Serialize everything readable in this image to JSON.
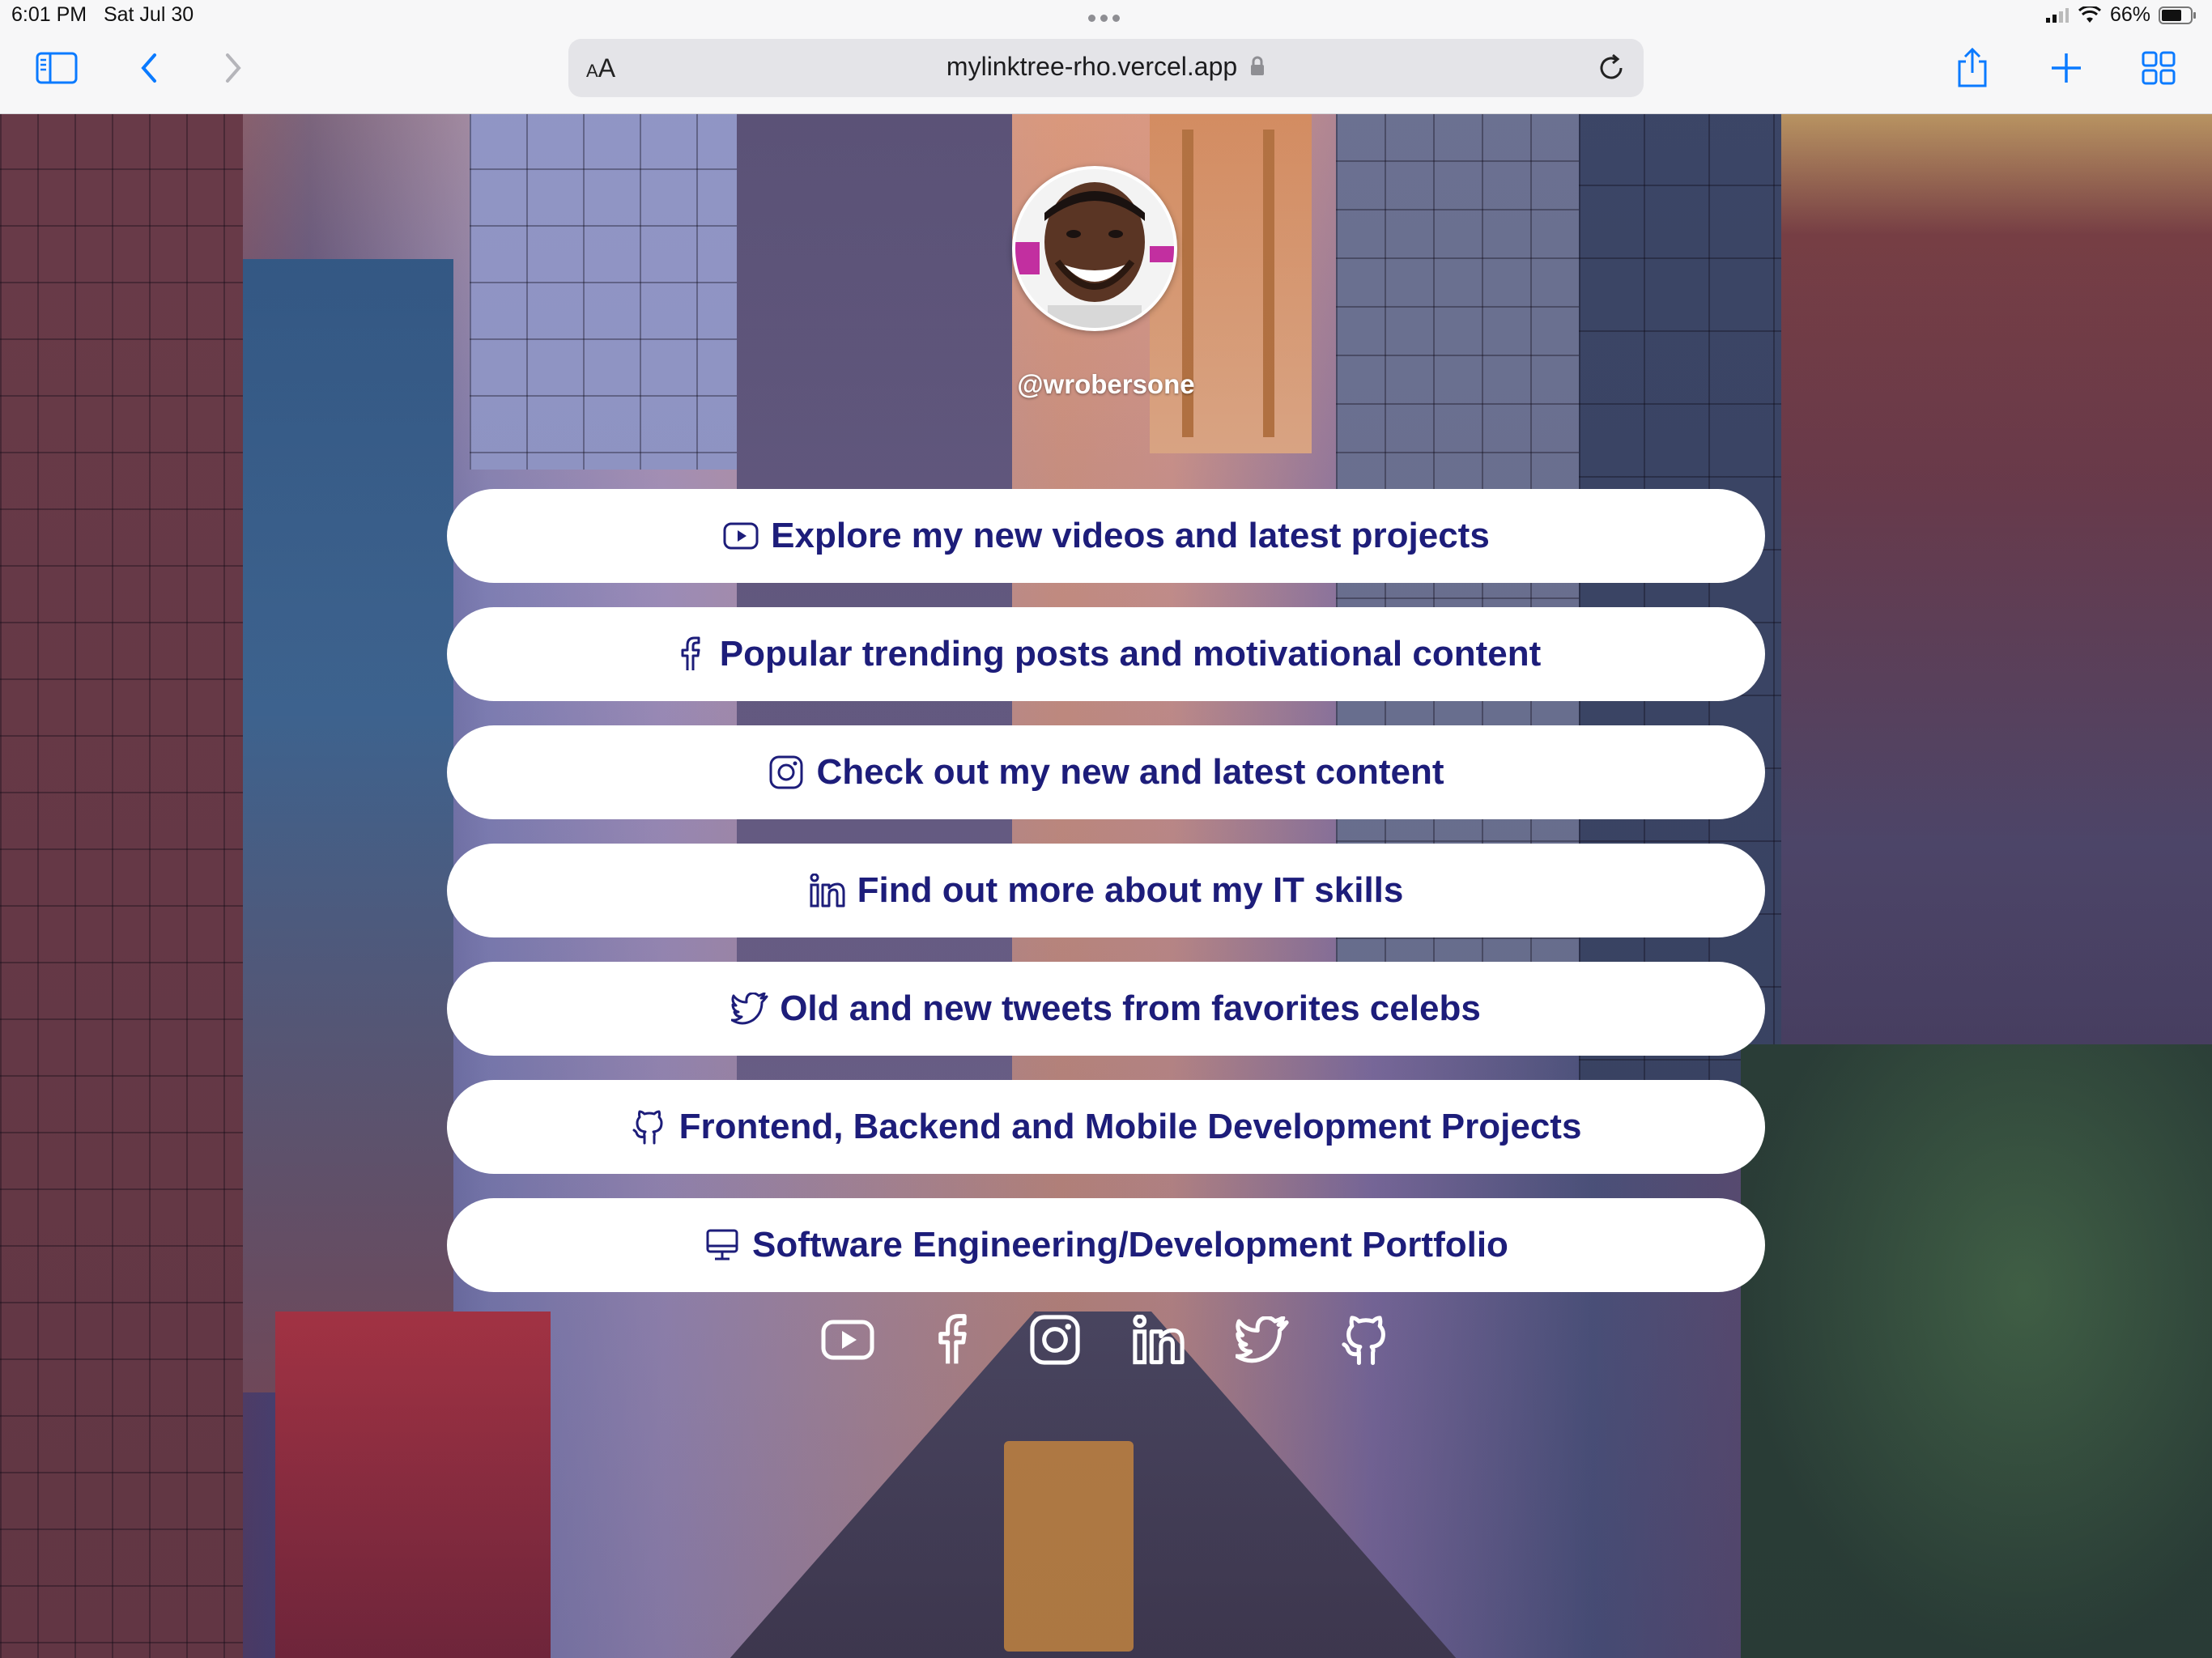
{
  "status_bar": {
    "time": "6:01 PM",
    "date": "Sat Jul 30",
    "battery": "66%"
  },
  "browser": {
    "aa_label_small": "A",
    "aa_label_large": "A",
    "url": "mylinktree-rho.vercel.app"
  },
  "profile": {
    "handle": "@wrobersone"
  },
  "links": [
    {
      "label": "Explore my new videos and latest projects",
      "icon": "youtube-icon"
    },
    {
      "label": "Popular trending posts and motivational content",
      "icon": "facebook-icon"
    },
    {
      "label": "Check out my new and latest content",
      "icon": "instagram-icon"
    },
    {
      "label": "Find out more about my IT skills",
      "icon": "linkedin-icon"
    },
    {
      "label": "Old and new tweets from favorites celebs",
      "icon": "twitter-icon"
    },
    {
      "label": "Frontend, Backend and Mobile Development Projects",
      "icon": "github-icon"
    },
    {
      "label": "Software Engineering/Development Portfolio",
      "icon": "monitor-icon"
    }
  ],
  "social_icons": [
    "youtube-icon",
    "facebook-icon",
    "instagram-icon",
    "linkedin-icon",
    "twitter-icon",
    "github-icon"
  ],
  "colors": {
    "link_text": "#1d1d7a",
    "button_bg": "#ffffff",
    "ios_blue": "#0a7aff"
  }
}
